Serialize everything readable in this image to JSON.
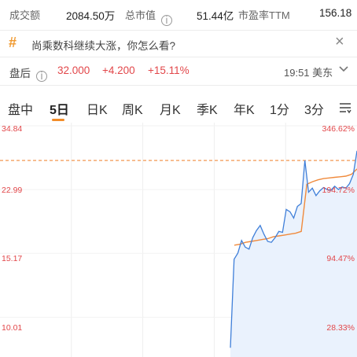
{
  "stats": {
    "volume_label": "成交额",
    "volume_value": "2084.50万",
    "mktcap_label": "总市值",
    "mktcap_value": "51.44亿",
    "pe_label": "市盈率TTM",
    "pe_value": "156.18",
    "info_icon": "info-circle-icon"
  },
  "promo": {
    "icon": "hash-icon",
    "text": "尚乘数科继续大涨，你怎么看?",
    "close_icon": "close-icon"
  },
  "after_hours": {
    "label": "盘后",
    "info_icon": "info-circle-icon",
    "price": "32.000",
    "change": "+4.200",
    "change_pct": "+15.11%",
    "time": "19:51 美东",
    "expand_icon": "chevron-down-icon"
  },
  "tabs": [
    "盘中",
    "5日",
    "日K",
    "周K",
    "月K",
    "季K",
    "年K",
    "1分",
    "3分"
  ],
  "active_tab": "5日",
  "tab_menu_icon": "settings-lines-icon",
  "colors": {
    "up": "#e2474a",
    "line": "#3f7fd9",
    "avg": "#f08a3c",
    "fill": "#eaf2fd",
    "promo_accent": "#f09a31"
  },
  "chart_data": {
    "type": "line",
    "y_left_labels": [
      "34.84",
      "22.99",
      "15.17",
      "10.01"
    ],
    "y_right_labels": [
      "346.62%",
      "194.72%",
      "94.47%",
      "28.33%"
    ],
    "y_scale": "log",
    "ylim": [
      7.8,
      34.84
    ],
    "days": 5,
    "reference_line": 27.8,
    "series": [
      {
        "values": [
          8.2,
          14.6,
          15.2,
          16.5,
          15.8,
          15.6,
          16.8,
          17.6,
          18.2,
          17.2,
          16.4,
          16.3,
          16.8,
          17.5,
          17.4,
          20.2,
          19.9,
          19.1,
          20.6,
          21.0,
          27.8,
          22.6,
          23.2,
          22.1,
          22.8,
          23.3,
          23.0,
          22.9,
          23.5,
          23.0,
          23.4,
          23.2,
          23.9,
          25.4,
          29.6
        ]
      },
      {
        "values": [
          16.0,
          16.1,
          16.3,
          16.4,
          16.5,
          16.6,
          16.7,
          16.9,
          17.0,
          17.1,
          17.2,
          17.3,
          17.5,
          23.8,
          24.2,
          24.5,
          24.7,
          24.8,
          24.9,
          25.0,
          25.1,
          25.4,
          26.3
        ]
      }
    ]
  }
}
